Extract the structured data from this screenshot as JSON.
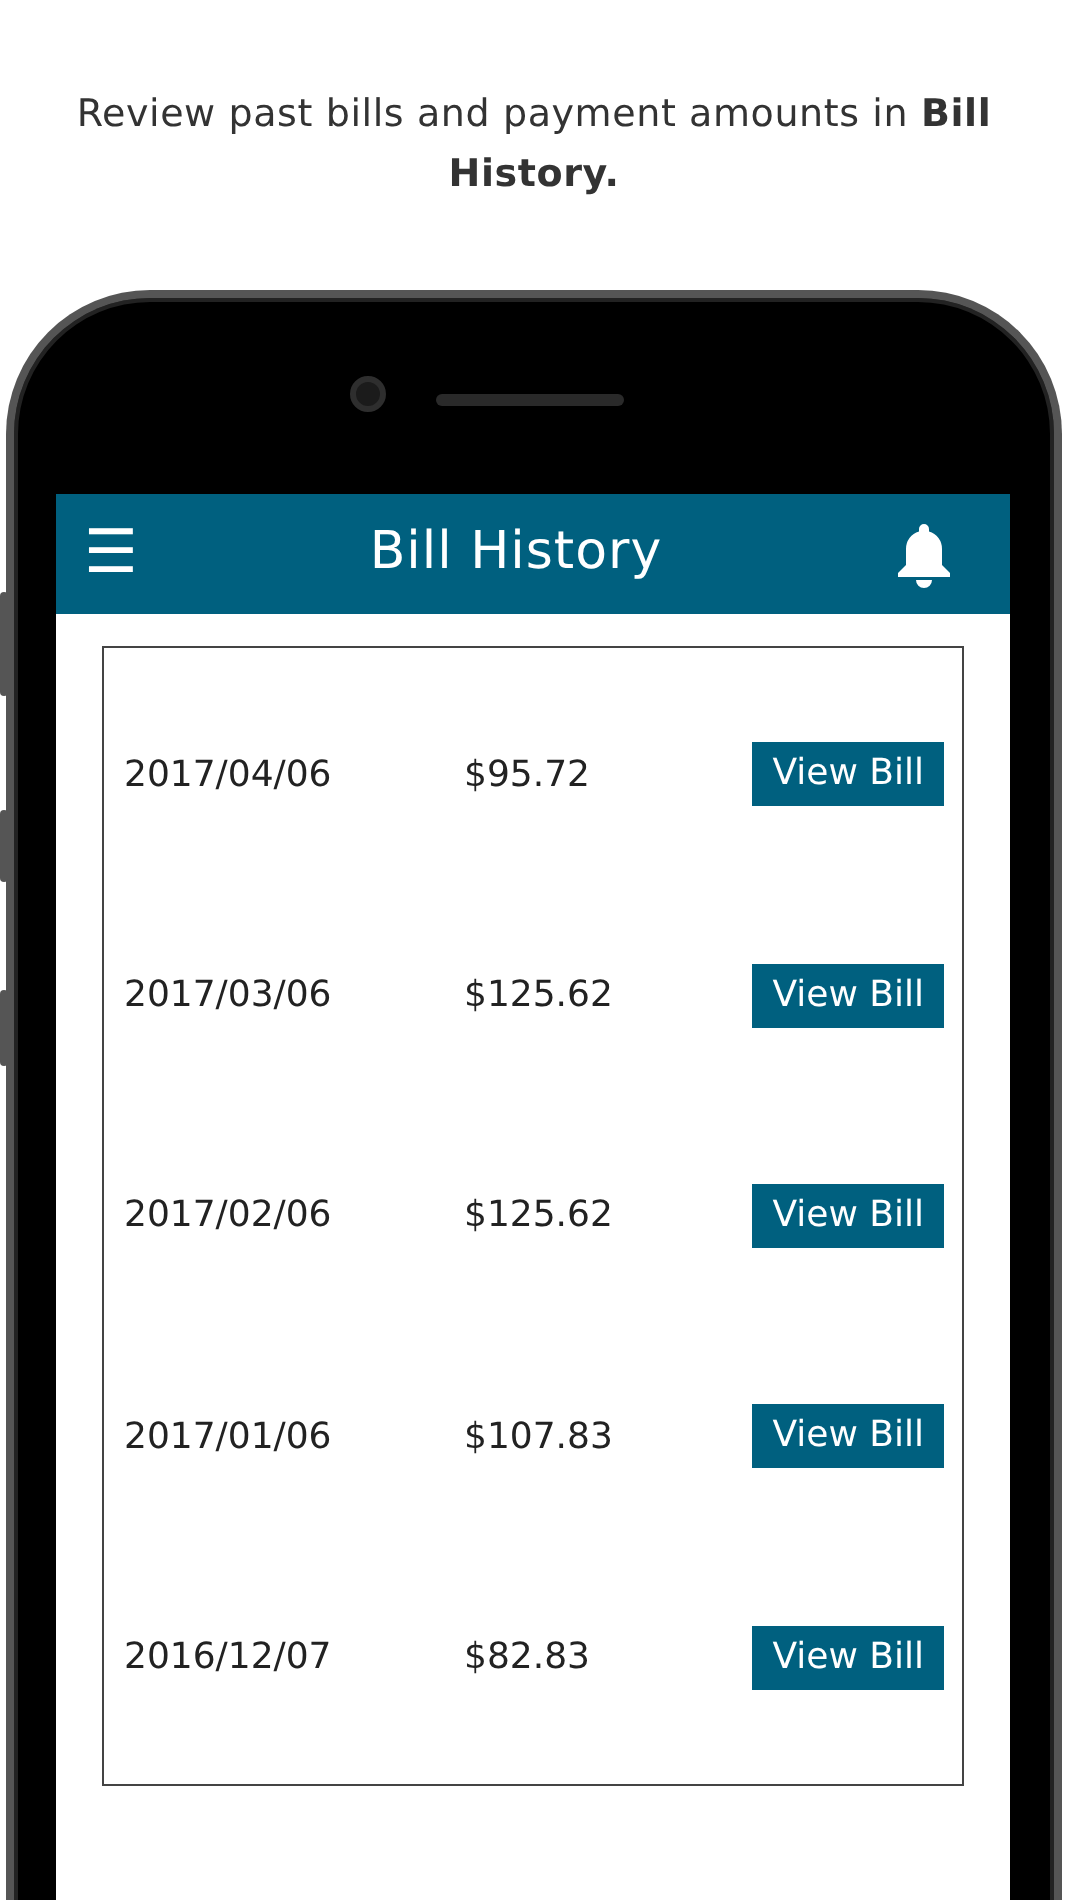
{
  "caption": "Review past bills and payment amounts in **Bill History.**",
  "app_bar": {
    "menu_icon": "☰",
    "title": "Bill History"
  },
  "bills": [
    {
      "date": "2017/04/06",
      "amount": "$95.72",
      "button": "View Bill"
    },
    {
      "date": "2017/03/06",
      "amount": "$125.62",
      "button": "View Bill"
    },
    {
      "date": "2017/02/06",
      "amount": "$125.62",
      "button": "View Bill"
    },
    {
      "date": "2017/01/06",
      "amount": "$107.83",
      "button": "View Bill"
    },
    {
      "date": "2016/12/07",
      "amount": "$82.83",
      "button": "View Bill"
    }
  ]
}
